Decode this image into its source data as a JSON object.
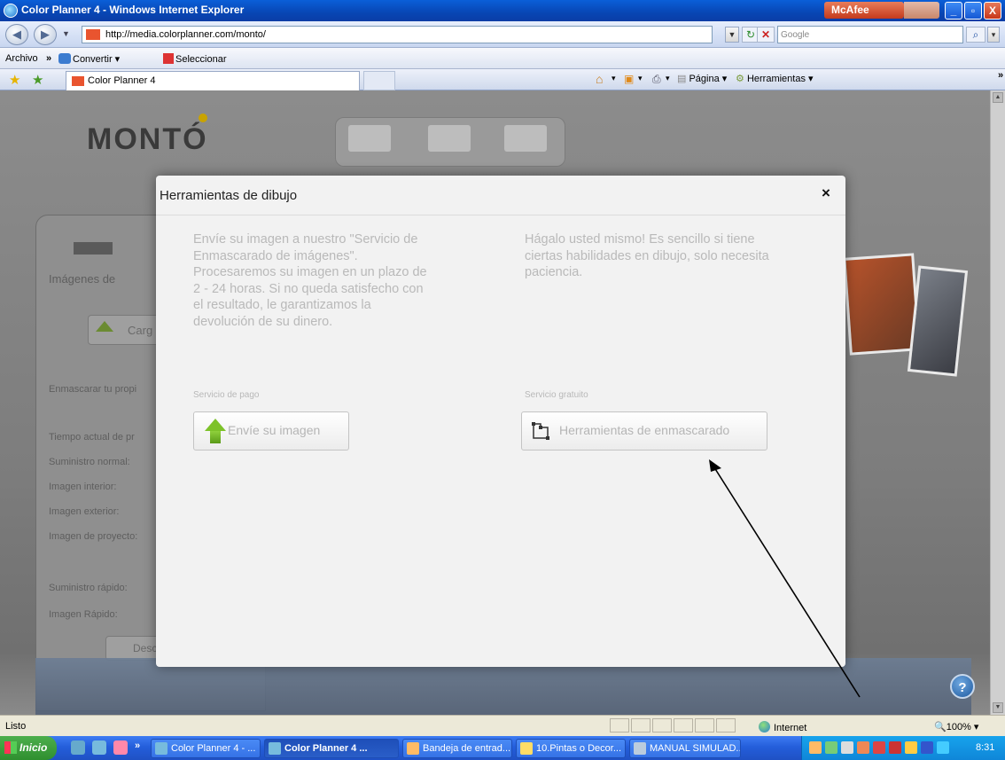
{
  "window": {
    "title": "Color Planner 4 - Windows Internet Explorer",
    "mcafee": "McAfee",
    "buttons": {
      "minimize": "_",
      "maximize": "▫",
      "close": "X"
    }
  },
  "address_bar": {
    "url": "http://media.colorplanner.com/monto/",
    "search_placeholder": "Google"
  },
  "menu": {
    "archivo": "Archivo",
    "chevron": "»",
    "convertir": "Convertir",
    "seleccionar": "Seleccionar"
  },
  "tabs": {
    "active_tab": "Color Planner 4",
    "command_bar": {
      "pagina": "Página",
      "herramientas": "Herramientas"
    }
  },
  "page": {
    "logo": "MONTÓ",
    "left_panel": {
      "imagenes": "Imágenes de",
      "cargar": "Carg",
      "enmascarar": "Enmascarar tu propi",
      "tiempo": "Tiempo actual de pr",
      "suministro_normal": "Suministro normal:",
      "imagen_interior": "Imagen interior:",
      "imagen_exterior": "Imagen exterior:",
      "imagen_proyecto": "Imagen de proyecto:",
      "suministro_rapido": "Suministro rápido:",
      "imagen_rapido": "Imagen Rápido:",
      "descargar": "Desca"
    },
    "help": "?"
  },
  "modal": {
    "title": "Herramientas de dibujo",
    "close": "×",
    "paid": {
      "description_lines": [
        "Envíe su imagen a nuestro \"Servicio de",
        "Enmascarado de imágenes\".",
        "Procesaremos su imagen en un plazo de",
        "2 - 24 horas. Si no queda satisfecho con",
        "el resultado, le garantizamos la",
        "devolución de su dinero."
      ],
      "label": "Servicio de pago",
      "button": "Envíe su imagen"
    },
    "free": {
      "description_lines": [
        "Hágalo usted mismo! Es sencillo si tiene",
        "ciertas habilidades en dibujo, solo necesita",
        "paciencia."
      ],
      "label": "Servicio gratuito",
      "button": "Herramientas de enmascarado"
    }
  },
  "status_bar": {
    "status": "Listo",
    "zone": "Internet",
    "zoom": "100%"
  },
  "taskbar": {
    "start": "Inicio",
    "chevron": "»",
    "items": [
      "Color Planner 4 - ...",
      "Color Planner 4 ...",
      "Bandeja de entrad...",
      "10.Pintas o Decor...",
      "MANUAL SIMULAD..."
    ],
    "clock": "8:31"
  },
  "colors": {
    "title_bar": "#0846b4",
    "modal_bg": "#f2f2f2",
    "green_arrow": "#7dc22a",
    "taskbar": "#245edb"
  }
}
